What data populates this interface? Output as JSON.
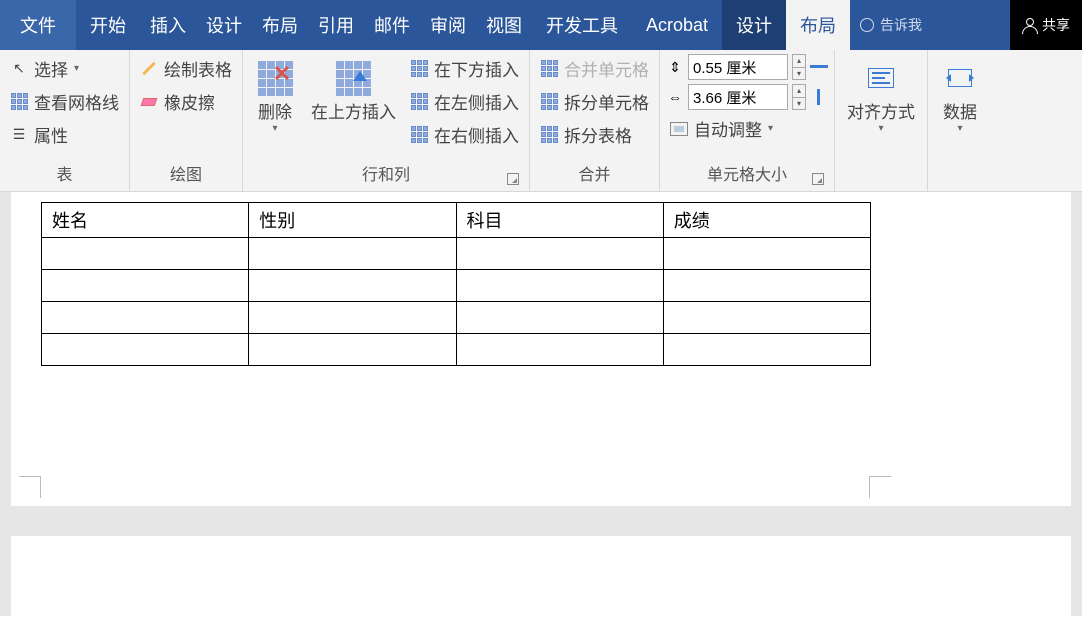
{
  "tabs": {
    "file": "文件",
    "home": "开始",
    "insert": "插入",
    "design": "设计",
    "layout": "布局",
    "references": "引用",
    "mailings": "邮件",
    "review": "审阅",
    "view": "视图",
    "developer": "开发工具",
    "acrobat": "Acrobat",
    "table_design": "设计",
    "table_layout": "布局"
  },
  "tell_me": "告诉我",
  "share": "共享",
  "ribbon": {
    "group_table": {
      "label": "表",
      "select": "选择",
      "gridlines": "查看网格线",
      "properties": "属性"
    },
    "group_draw": {
      "label": "绘图",
      "draw_table": "绘制表格",
      "eraser": "橡皮擦"
    },
    "group_rc": {
      "label": "行和列",
      "delete": "删除",
      "insert_above": "在上方插入",
      "insert_below": "在下方插入",
      "insert_left": "在左侧插入",
      "insert_right": "在右侧插入"
    },
    "group_merge": {
      "label": "合并",
      "merge_cells": "合并单元格",
      "split_cells": "拆分单元格",
      "split_table": "拆分表格"
    },
    "group_size": {
      "label": "单元格大小",
      "height": "0.55 厘米",
      "width": "3.66 厘米",
      "autofit": "自动调整"
    },
    "group_align": {
      "label": "对齐方式"
    },
    "group_data": {
      "label": "数据"
    }
  },
  "table": {
    "headers": [
      "姓名",
      "性别",
      "科目",
      "成绩"
    ]
  }
}
